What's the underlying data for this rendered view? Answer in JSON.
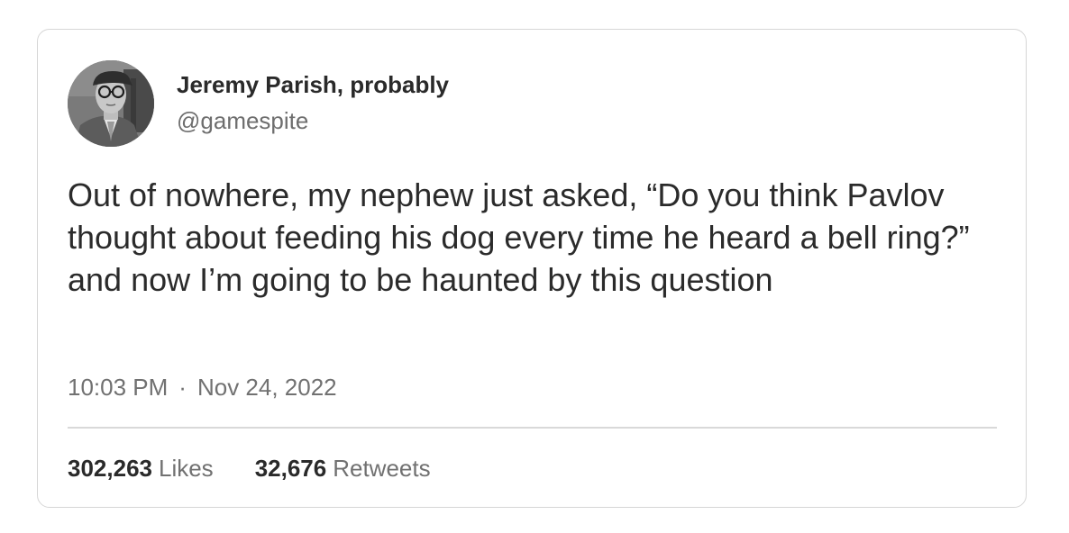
{
  "tweet": {
    "author": {
      "display_name": "Jeremy Parish, probably",
      "handle": "@gamespite",
      "avatar_icon": "profile-photo"
    },
    "text": "Out of nowhere, my nephew just asked, “Do you think Pavlov thought about feeding his dog every time he heard a bell ring?” and now I’m going to be haunted by this question",
    "time": "10:03 PM",
    "separator": "·",
    "date": "Nov 24, 2022",
    "stats": {
      "likes_count": "302,263",
      "likes_label": "Likes",
      "retweets_count": "32,676",
      "retweets_label": "Retweets"
    }
  },
  "colors": {
    "card_border": "#d6d6d6",
    "text_primary": "#2b2b2b",
    "text_secondary": "#717171",
    "divider": "#d9d9d9"
  }
}
